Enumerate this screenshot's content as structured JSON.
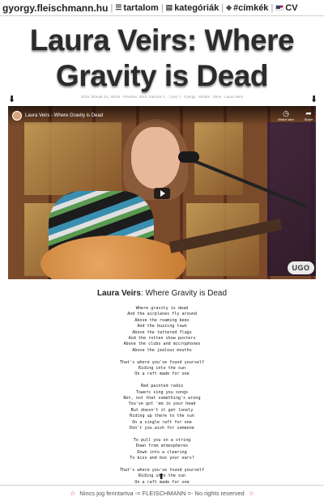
{
  "nav": {
    "site": "gyorgy.fleischmann.hu",
    "items": [
      {
        "label": "tartalom",
        "icon": "list-icon"
      },
      {
        "label": "kategóriák",
        "icon": "grid-icon"
      },
      {
        "label": "#címkék",
        "icon": "tag-icon"
      },
      {
        "label": "CV",
        "icon": "flag-icon"
      }
    ]
  },
  "post": {
    "title": "Laura Veirs: Where Gravity is Dead",
    "meta": "2015. február 24., 09:05 · Frissítve: 2015. március 1. · ( perc ) · György · kérdés · Zene · Laura Veirs",
    "arrow_down": "⬇"
  },
  "video": {
    "title": "Laura Veirs - Where Gravity is Dead",
    "watch_later": "Watch later",
    "share": "Share",
    "logo": "UGO"
  },
  "song": {
    "artist": "Laura Veirs",
    "separator": ":",
    "name": "Where Gravity is Dead",
    "stanzas": [
      [
        "Where gravity is dead",
        "And the airplanes fly around",
        "Above the roaming bees",
        "And the buzzing town",
        "Above the tattered flags",
        "And the rotten show posters",
        "Above the clubs and microphones",
        "Above the jealous mouths"
      ],
      [
        "That's where you've found yourself",
        "Riding into the sun",
        "On a raft made for one"
      ],
      [
        "Red painted radio",
        "Towers sing you songs",
        "Not, not that something's wrong",
        "You've got 'em in your head",
        "But doesn't it get lonely",
        "Riding up there to the sun",
        "On a single raft for one",
        "Don't you wish for someone"
      ],
      [
        "To pull you on a string",
        "Down from atmospheres",
        "Down into a clearing",
        "To kiss and box your ears?"
      ],
      [
        "That's where you've found yourself",
        "Riding into the sun",
        "On a raft made for one"
      ]
    ]
  },
  "page": {
    "arrow_up": "⬆"
  },
  "footer": {
    "text": "Nincs jog fenntartva -= FLEISCHMANN =- No rights reserved",
    "star": "☆"
  }
}
